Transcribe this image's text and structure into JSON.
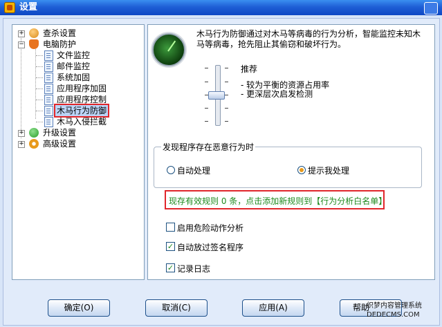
{
  "window": {
    "title": "设置"
  },
  "tree": {
    "items": [
      {
        "label": "查杀设置",
        "icon": "user-scan-icon"
      },
      {
        "label": "电脑防护",
        "icon": "shield-icon"
      },
      {
        "label": "文件监控",
        "icon": "doc-icon"
      },
      {
        "label": "邮件监控",
        "icon": "doc-icon"
      },
      {
        "label": "系统加固",
        "icon": "doc-icon"
      },
      {
        "label": "应用程序加固",
        "icon": "doc-icon"
      },
      {
        "label": "应用程序控制",
        "icon": "doc-icon"
      },
      {
        "label": "木马行为防御",
        "icon": "doc-icon"
      },
      {
        "label": "木马入侵拦截",
        "icon": "doc-icon"
      },
      {
        "label": "升级设置",
        "icon": "update-icon"
      },
      {
        "label": "高级设置",
        "icon": "gear-icon"
      }
    ]
  },
  "panel": {
    "description": "木马行为防御通过对木马等病毒的行为分析，智能监控未知木马等病毒，抢先阻止其偷窃和破坏行为。",
    "level": {
      "value_label": "推荐",
      "detail1": "- 较为平衡的资源占用率",
      "detail2": "- 更深层次启发检测",
      "position": 0.5
    },
    "group": {
      "legend": "发现程序存在恶意行为时",
      "option_auto": "自动处理",
      "option_prompt": "提示我处理",
      "selected": "option_prompt"
    },
    "rules_text": "现存有效规则 0 条，点击添加新规则到【行为分析白名单】",
    "checkboxes": {
      "danger_analysis": {
        "label": "启用危险动作分析",
        "checked": false
      },
      "auto_allow_signed": {
        "label": "自动放过签名程序",
        "checked": true
      },
      "log": {
        "label": "记录日志",
        "checked": true
      }
    }
  },
  "buttons": {
    "ok": "确定(O)",
    "cancel": "取消(C)",
    "apply": "应用(A)",
    "help": "帮助"
  },
  "watermark": {
    "line1": "织梦内容管理系统",
    "line2": "DEDECMS.COM"
  },
  "colors": {
    "title_bar": "#1f5fd6",
    "highlight_border": "#e0252a",
    "link_green": "#1e8a1e"
  }
}
